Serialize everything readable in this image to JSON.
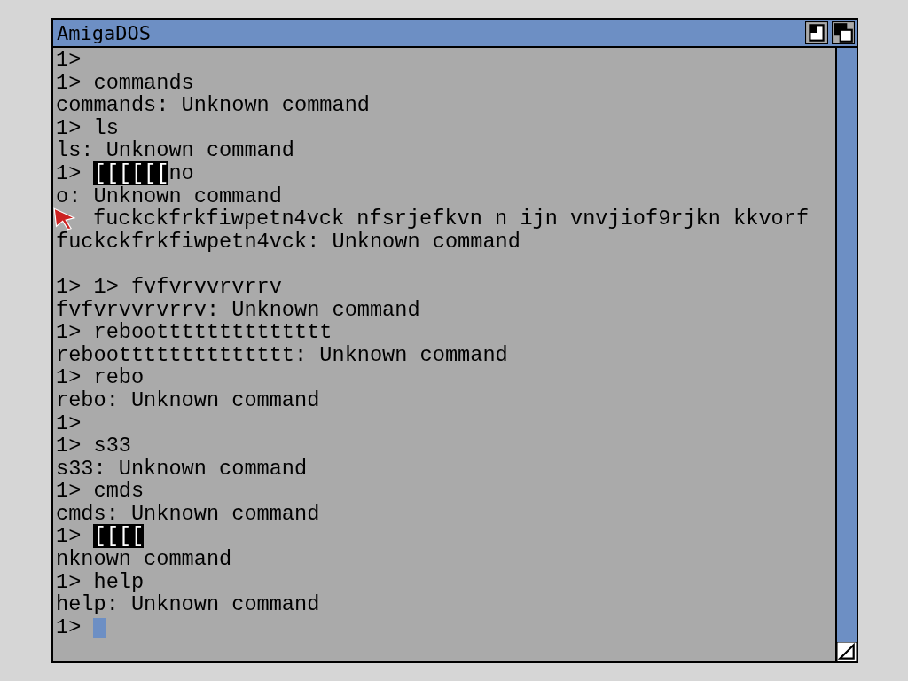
{
  "window": {
    "title": "AmigaDOS"
  },
  "lines": [
    {
      "kind": "text",
      "segments": [
        {
          "text": "1>",
          "inverse": false
        }
      ]
    },
    {
      "kind": "text",
      "segments": [
        {
          "text": "1> commands",
          "inverse": false
        }
      ]
    },
    {
      "kind": "text",
      "segments": [
        {
          "text": "commands: Unknown command",
          "inverse": false
        }
      ]
    },
    {
      "kind": "text",
      "segments": [
        {
          "text": "1> ls",
          "inverse": false
        }
      ]
    },
    {
      "kind": "text",
      "segments": [
        {
          "text": "ls: Unknown command",
          "inverse": false
        }
      ]
    },
    {
      "kind": "text",
      "segments": [
        {
          "text": "1> ",
          "inverse": false
        },
        {
          "text": "[[[[[[",
          "inverse": true
        },
        {
          "text": "no",
          "inverse": false
        }
      ]
    },
    {
      "kind": "text",
      "segments": [
        {
          "text": "o: Unknown command",
          "inverse": false
        }
      ]
    },
    {
      "kind": "pointer",
      "segments": [
        {
          "text": "fuckckfrkfiwpetn4vck nfsrjefkvn n ijn vnvjiof9rjkn kkvorf",
          "inverse": false
        }
      ]
    },
    {
      "kind": "text",
      "segments": [
        {
          "text": "fuckckfrkfiwpetn4vck: Unknown command",
          "inverse": false
        }
      ]
    },
    {
      "kind": "blank"
    },
    {
      "kind": "text",
      "segments": [
        {
          "text": "1> 1> fvfvrvvrvrrv",
          "inverse": false
        }
      ]
    },
    {
      "kind": "text",
      "segments": [
        {
          "text": "fvfvrvvrvrrv: Unknown command",
          "inverse": false
        }
      ]
    },
    {
      "kind": "text",
      "segments": [
        {
          "text": "1> rebootttttttttttttt",
          "inverse": false
        }
      ]
    },
    {
      "kind": "text",
      "segments": [
        {
          "text": "rebootttttttttttttt: Unknown command",
          "inverse": false
        }
      ]
    },
    {
      "kind": "text",
      "segments": [
        {
          "text": "1> rebo",
          "inverse": false
        }
      ]
    },
    {
      "kind": "text",
      "segments": [
        {
          "text": "rebo: Unknown command",
          "inverse": false
        }
      ]
    },
    {
      "kind": "text",
      "segments": [
        {
          "text": "1>",
          "inverse": false
        }
      ]
    },
    {
      "kind": "text",
      "segments": [
        {
          "text": "1> s33",
          "inverse": false
        }
      ]
    },
    {
      "kind": "text",
      "segments": [
        {
          "text": "s33: Unknown command",
          "inverse": false
        }
      ]
    },
    {
      "kind": "text",
      "segments": [
        {
          "text": "1> cmds",
          "inverse": false
        }
      ]
    },
    {
      "kind": "text",
      "segments": [
        {
          "text": "cmds: Unknown command",
          "inverse": false
        }
      ]
    },
    {
      "kind": "text",
      "segments": [
        {
          "text": "1> ",
          "inverse": false
        },
        {
          "text": "[[[[",
          "inverse": true
        }
      ]
    },
    {
      "kind": "text",
      "segments": [
        {
          "text": "nknown command",
          "inverse": false
        }
      ]
    },
    {
      "kind": "text",
      "segments": [
        {
          "text": "1> help",
          "inverse": false
        }
      ]
    },
    {
      "kind": "text",
      "segments": [
        {
          "text": "help: Unknown command",
          "inverse": false
        }
      ]
    },
    {
      "kind": "input",
      "segments": [
        {
          "text": "1> ",
          "inverse": false
        }
      ]
    }
  ]
}
